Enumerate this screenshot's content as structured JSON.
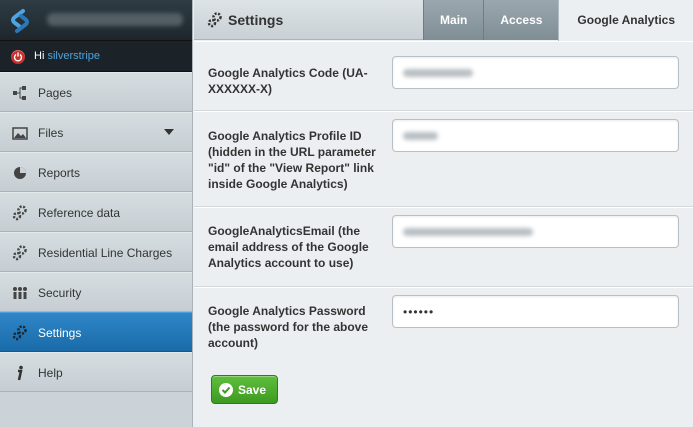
{
  "user": {
    "greeting": "Hi",
    "name": "silverstripe"
  },
  "sidebar": {
    "items": [
      {
        "label": "Pages",
        "icon": "sitemap-icon"
      },
      {
        "label": "Files",
        "icon": "image-icon"
      },
      {
        "label": "Reports",
        "icon": "pie-chart-icon"
      },
      {
        "label": "Reference data",
        "icon": "gears-icon"
      },
      {
        "label": "Residential Line Charges",
        "icon": "gears-icon"
      },
      {
        "label": "Security",
        "icon": "people-icon"
      },
      {
        "label": "Settings",
        "icon": "gears-icon"
      },
      {
        "label": "Help",
        "icon": "info-icon"
      }
    ]
  },
  "header": {
    "title": "Settings"
  },
  "tabs": [
    "Main",
    "Access",
    "Google Analytics"
  ],
  "form": {
    "fields": [
      {
        "label": "Google Analytics Code (UA-XXXXXX-X)"
      },
      {
        "label": "Google Analytics Profile ID (hidden in the URL parameter \"id\" of the \"View Report\" link inside Google Analytics)"
      },
      {
        "label": "GoogleAnalyticsEmail (the email address of the Google Analytics account to use)"
      },
      {
        "label": "Google Analytics Password (the password for the above account)",
        "value": "••••••"
      }
    ],
    "save_label": "Save"
  },
  "colors": {
    "accent": "#1f74b4",
    "save": "#4aa82c",
    "power": "#c9302c"
  }
}
